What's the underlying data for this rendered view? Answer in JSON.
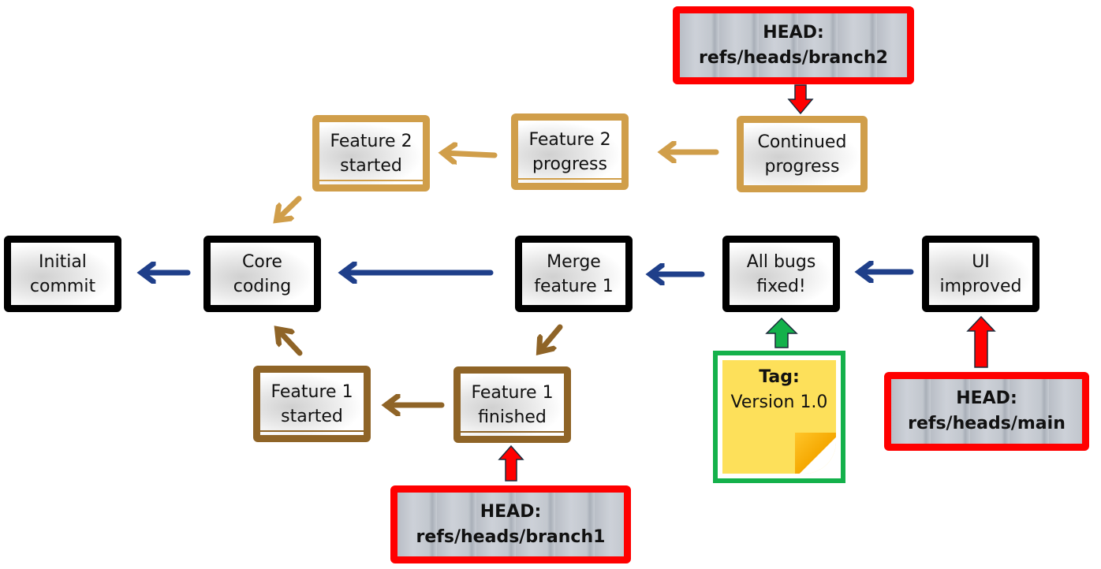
{
  "commits": {
    "initial_commit": {
      "line1": "Initial",
      "line2": "commit"
    },
    "core_coding": {
      "line1": "Core",
      "line2": "coding"
    },
    "merge_feature_1": {
      "line1": "Merge",
      "line2": "feature 1"
    },
    "all_bugs_fixed": {
      "line1": "All bugs",
      "line2": "fixed!"
    },
    "ui_improved": {
      "line1": "UI",
      "line2": "improved"
    },
    "feature_2_started": {
      "line1": "Feature 2",
      "line2": "started"
    },
    "feature_2_progress": {
      "line1": "Feature 2",
      "line2": "progress"
    },
    "continued_progress": {
      "line1": "Continued",
      "line2": "progress"
    },
    "feature_1_started": {
      "line1": "Feature 1",
      "line2": "started"
    },
    "feature_1_finished": {
      "line1": "Feature 1",
      "line2": "finished"
    }
  },
  "refs": {
    "branch2": {
      "line1": "HEAD:",
      "line2": "refs/heads/branch2"
    },
    "branch1": {
      "line1": "HEAD:",
      "line2": "refs/heads/branch1"
    },
    "main": {
      "line1": "HEAD:",
      "line2": "refs/heads/main"
    }
  },
  "tag": {
    "label": "Tag:",
    "value": "Version 1.0"
  },
  "colors": {
    "main_branch": "#000000",
    "main_arrow": "#1f3f8a",
    "feature2": "#d09e4a",
    "feature1": "#8f6427",
    "head_ref": "#ff0000",
    "tag_border": "#14b14b",
    "tag_note": "#fde05a"
  }
}
